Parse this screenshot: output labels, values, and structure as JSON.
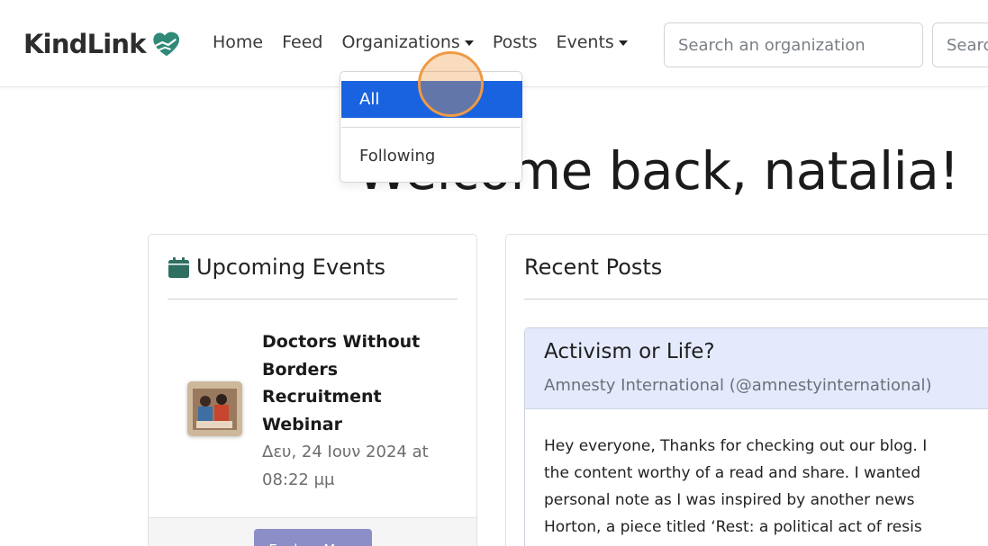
{
  "navbar": {
    "brand": "KindLink",
    "links": {
      "home": "Home",
      "feed": "Feed",
      "organizations": "Organizations",
      "posts": "Posts",
      "events": "Events"
    },
    "search_org_placeholder": "Search an organization",
    "search_posts_placeholder": "Search"
  },
  "organizations_menu": {
    "items": [
      "All",
      "Following"
    ],
    "active": "All"
  },
  "welcome": "Welcome back, natalia!",
  "events_card": {
    "title": "Upcoming Events",
    "event": {
      "title": "Doctors Without Borders Recruitment Webinar",
      "date": "Δευ, 24 Ιουν 2024 at 08:22 μμ"
    },
    "button": "Explore More"
  },
  "posts_card": {
    "title": "Recent Posts",
    "post": {
      "title": "Activism or Life?",
      "author": "Amnesty International (@amnestyinternational)",
      "body_lines": [
        "Hey everyone, Thanks for checking out our blog. I",
        "the content worthy of a read and share. I wanted",
        "personal note as I was inspired by another news",
        "Horton, a piece titled ‘Rest: a political act of resis"
      ]
    }
  },
  "colors": {
    "accent": "#1a63e0",
    "post_header": "#e4eafc",
    "button": "#8c8fc7",
    "cursor": "#ef9a44"
  }
}
